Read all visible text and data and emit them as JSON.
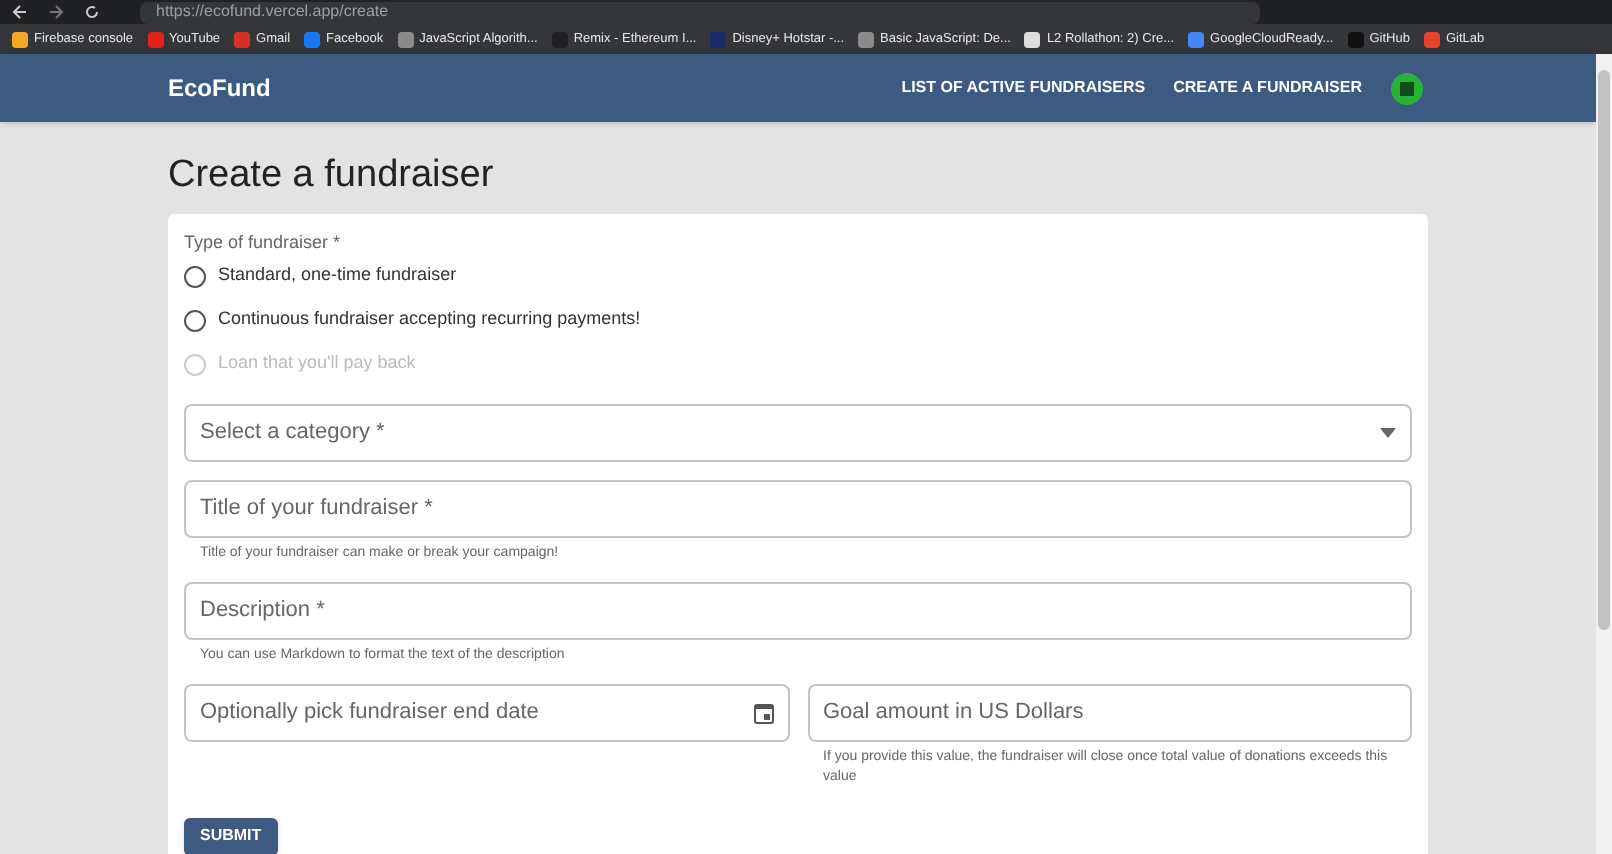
{
  "browser": {
    "url": "https://ecofund.vercel.app/create",
    "bookmarks": [
      {
        "label": "Firebase console",
        "color": "#f5a623"
      },
      {
        "label": "YouTube",
        "color": "#e62117"
      },
      {
        "label": "Gmail",
        "color": "#d93025"
      },
      {
        "label": "Facebook",
        "color": "#1877f2"
      },
      {
        "label": "JavaScript Algorith...",
        "color": "#8a8a8a"
      },
      {
        "label": "Remix - Ethereum I...",
        "color": "#222222"
      },
      {
        "label": "Disney+ Hotstar -...",
        "color": "#1a2a6c"
      },
      {
        "label": "Basic JavaScript: De...",
        "color": "#8a8a8a"
      },
      {
        "label": "L2 Rollathon: 2) Cre...",
        "color": "#dddddd"
      },
      {
        "label": "GoogleCloudReady...",
        "color": "#4285f4"
      },
      {
        "label": "GitHub",
        "color": "#111111"
      },
      {
        "label": "GitLab",
        "color": "#e24329"
      }
    ]
  },
  "header": {
    "brand": "EcoFund",
    "nav": [
      "LIST OF ACTIVE FUNDRAISERS",
      "CREATE A FUNDRAISER"
    ]
  },
  "page": {
    "title": "Create a fundraiser"
  },
  "form": {
    "type_label": "Type of fundraiser *",
    "options": [
      {
        "label": "Standard, one-time fundraiser",
        "selected": false,
        "disabled": false
      },
      {
        "label": "Continuous fundraiser accepting recurring payments!",
        "selected": false,
        "disabled": false
      },
      {
        "label": "Loan that you'll pay back",
        "selected": false,
        "disabled": true
      }
    ],
    "fields": [
      {
        "kind": "select",
        "label": "Select a category *"
      },
      {
        "kind": "text",
        "label": "Title of your fundraiser *",
        "helper": "Title of your fundraiser can make or break your campaign!"
      },
      {
        "kind": "text",
        "label": "Description *",
        "helper": "You can use Markdown to format the text of the description"
      }
    ],
    "end_date": {
      "label": "Optionally pick fundraiser end date"
    },
    "goal": {
      "label": "Goal amount in US Dollars",
      "helper": "If you provide this value, the fundraiser will close once total value of donations exceeds this value"
    },
    "submit": "SUBMIT"
  }
}
